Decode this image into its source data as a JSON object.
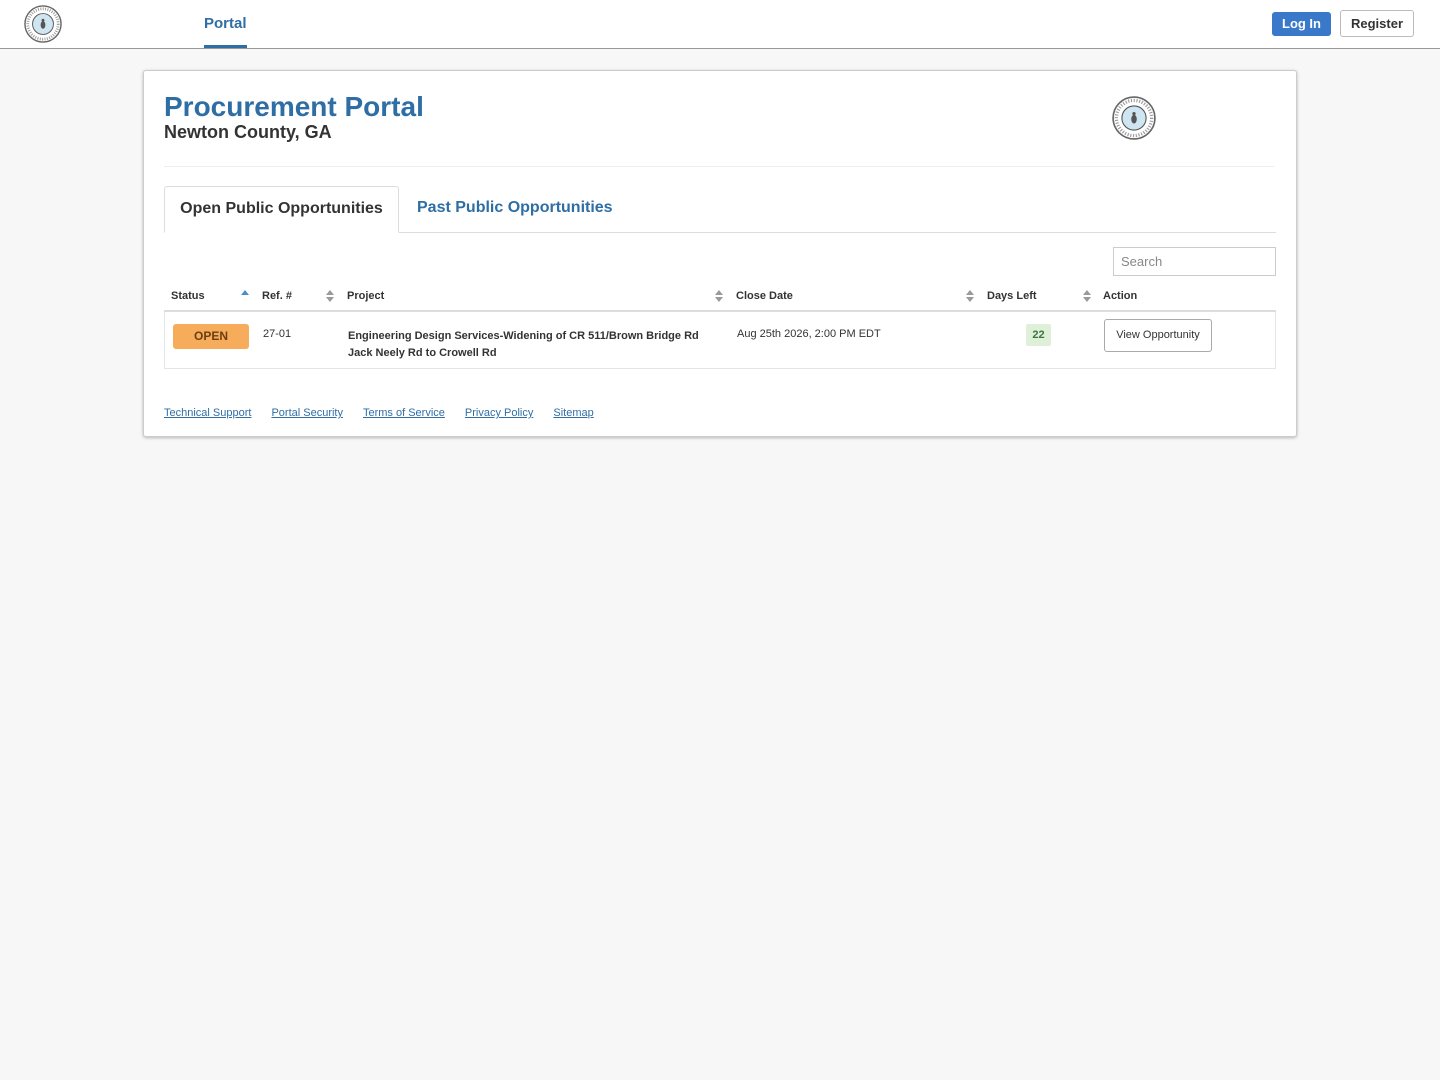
{
  "nav": {
    "portal_label": "Portal",
    "login_label": "Log In",
    "register_label": "Register"
  },
  "header": {
    "title": "Procurement Portal",
    "subtitle": "Newton County, GA"
  },
  "tabs": [
    {
      "label": "Open Public Opportunities"
    },
    {
      "label": "Past Public Opportunities"
    }
  ],
  "search": {
    "placeholder": "Search"
  },
  "table": {
    "columns": [
      "Status",
      "Ref. #",
      "Project",
      "Close Date",
      "Days Left",
      "Action"
    ],
    "rows": [
      {
        "status": "OPEN",
        "ref": "27-01",
        "project": "Engineering Design Services-Widening of CR 511/Brown Bridge Rd Jack Neely Rd to Crowell Rd",
        "close_date": "Aug 25th 2026, 2:00 PM EDT",
        "days_left": "22",
        "action": "View Opportunity"
      }
    ]
  },
  "footer": {
    "links": [
      "Technical Support",
      "Portal Security",
      "Terms of Service",
      "Privacy Policy",
      "Sitemap"
    ]
  },
  "colors": {
    "brand": "#2f6ea5",
    "login_button": "#3a78c9",
    "status_open": "#f7ac5c",
    "days_left_bg": "#dff0d8"
  }
}
